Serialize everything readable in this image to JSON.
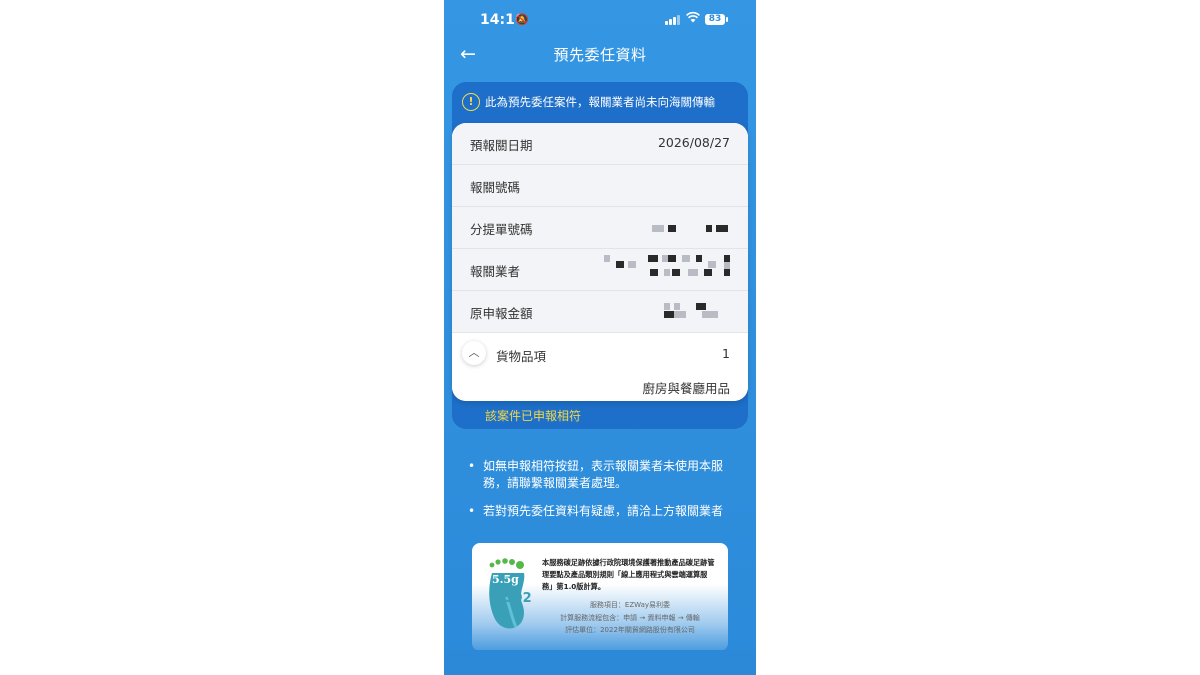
{
  "status_bar": {
    "time": "14:16",
    "battery": "83"
  },
  "header": {
    "title": "預先委任資料"
  },
  "notice": {
    "text": "此為預先委任案件，報關業者尚未向海關傳輸"
  },
  "details": {
    "rows": [
      {
        "label": "預報關日期",
        "value": "2026/08/27"
      },
      {
        "label": "報關號碼",
        "value": ""
      },
      {
        "label": "分提單號碼"
      },
      {
        "label": "報關業者"
      },
      {
        "label": "原申報金額"
      }
    ],
    "goods": {
      "label": "貨物品項",
      "count": "1",
      "item": "廚房與餐廳用品"
    }
  },
  "matched_text": "該案件已申報相符",
  "notes": [
    "如無申報相符按鈕，表示報關業者未使用本服務，請聯繫報關業者處理。",
    "若對預先委任資料有疑慮，請洽上方報關業者"
  ],
  "carbon_banner": {
    "weight": "5.5g",
    "co2": "CO2",
    "text": "本服務碳足跡依據行政院環境保護署推動產品碳足跡管理要點及產品類別規則「線上應用程式與雲端運算服務」第1.0版計算。",
    "service": "服務項目：EZWay易利委",
    "scope": "計算服務流程包含：申請 → 資料申報 → 傳輸",
    "unit": "評估單位：2022年關貿網路股份有限公司"
  },
  "colors": {
    "phone_bg": "#2d8fdf",
    "panel": "#1e6fc9",
    "warning": "#f5d94b",
    "matched": "#f0d84a"
  }
}
